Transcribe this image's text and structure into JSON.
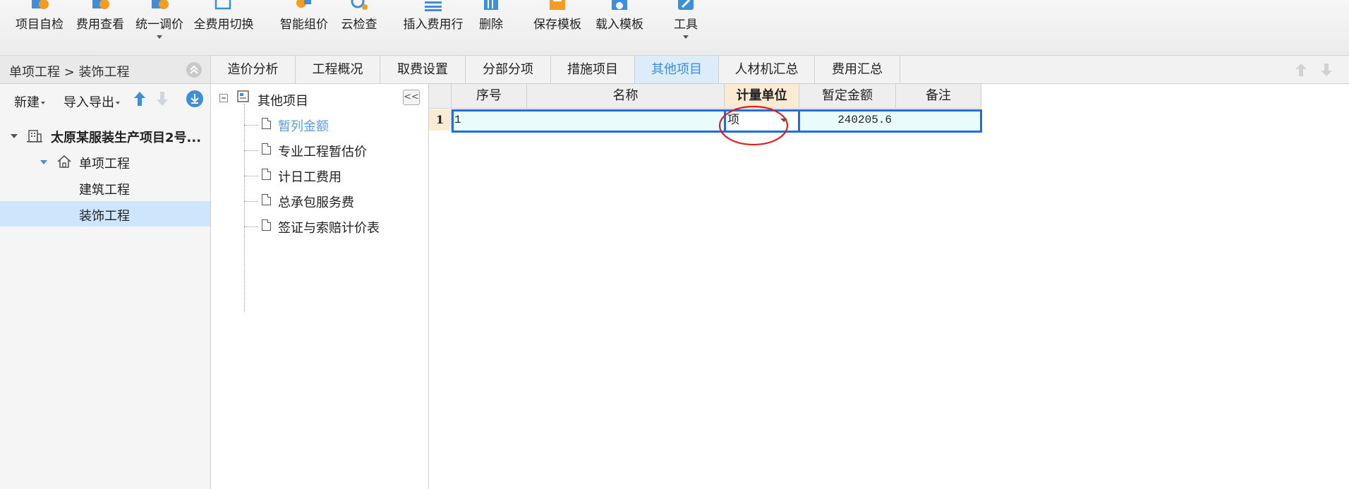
{
  "toolbar": {
    "items": [
      {
        "label": "项目自检",
        "icon": "check-doc-icon"
      },
      {
        "label": "费用查看",
        "icon": "view-cost-icon"
      },
      {
        "label": "统一调价",
        "icon": "adjust-price-icon",
        "dropdown": true
      },
      {
        "label": "全费用切换",
        "icon": "switch-icon"
      },
      {
        "label": "智能组价",
        "icon": "smart-price-icon"
      },
      {
        "label": "云检查",
        "icon": "cloud-check-icon"
      },
      {
        "label": "插入费用行",
        "icon": "insert-row-icon"
      },
      {
        "label": "删除",
        "icon": "delete-icon"
      },
      {
        "label": "保存模板",
        "icon": "save-template-icon"
      },
      {
        "label": "载入模板",
        "icon": "load-template-icon"
      },
      {
        "label": "工具",
        "icon": "tools-icon",
        "dropdown": true
      }
    ]
  },
  "breadcrumb": {
    "text": "单项工程 > 装饰工程"
  },
  "left_tools": {
    "new_label": "新建",
    "import_export_label": "导入导出"
  },
  "project_tree": {
    "root": "太原某服装生产项目2号...",
    "single_project": "单项工程",
    "children": [
      "建筑工程",
      "装饰工程"
    ],
    "selected": "装饰工程"
  },
  "tabs": {
    "items": [
      "造价分析",
      "工程概况",
      "取费设置",
      "分部分项",
      "措施项目",
      "其他项目",
      "人材机汇总",
      "费用汇总"
    ],
    "active": "其他项目"
  },
  "other_items_tree": {
    "root": "其他项目",
    "children": [
      "暂列金额",
      "专业工程暂估价",
      "计日工费用",
      "总承包服务费",
      "签证与索赔计价表"
    ],
    "selected": "暂列金额"
  },
  "grid": {
    "headers": [
      "序号",
      "名称",
      "计量单位",
      "暂定金额",
      "备注"
    ],
    "highlighted_header": "计量单位",
    "rows": [
      {
        "row_num": "1",
        "seq": "1",
        "name": "",
        "unit": "项",
        "amount": "240205.6",
        "remark": ""
      }
    ]
  },
  "colors": {
    "accent": "#3d8fdc",
    "selection_bg": "#cde6fb",
    "grid_row_bg": "#e9fbfb",
    "row_border": "#1e6fd9",
    "annotation_circle": "#e02020"
  }
}
